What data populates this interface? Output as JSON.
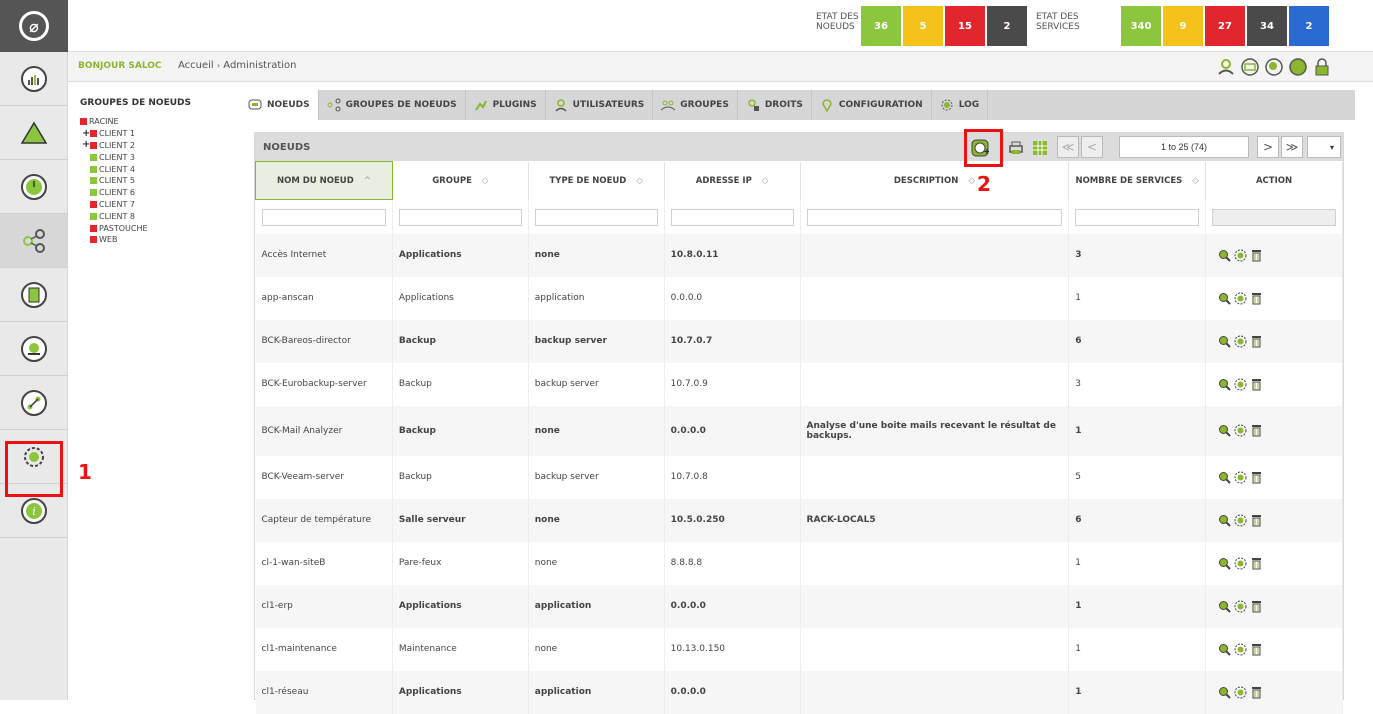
{
  "header": {
    "node_status_label": "ETAT DES NOEUDS",
    "node_stats": [
      {
        "value": "36",
        "color": "#8cc63f"
      },
      {
        "value": "5",
        "color": "#f4c21b"
      },
      {
        "value": "15",
        "color": "#e2262e"
      },
      {
        "value": "2",
        "color": "#4a4a4a"
      }
    ],
    "service_status_label": "ETAT DES SERVICES",
    "service_stats": [
      {
        "value": "340",
        "color": "#8cc63f"
      },
      {
        "value": "9",
        "color": "#f4c21b"
      },
      {
        "value": "27",
        "color": "#e2262e"
      },
      {
        "value": "34",
        "color": "#4a4a4a"
      },
      {
        "value": "2",
        "color": "#2a6bd1"
      }
    ]
  },
  "breadcrumb": {
    "greeting": "BONJOUR SALOC",
    "home": "Accueil",
    "separator": "›",
    "current": "Administration"
  },
  "annotations": {
    "one": "1",
    "two": "2"
  },
  "tree": {
    "title": "GROUPES DE NOEUDS",
    "nodes": [
      {
        "label": "RACINE",
        "color": "#e2262e",
        "plus": false,
        "indent": 0
      },
      {
        "label": "CLIENT 1",
        "color": "#e2262e",
        "plus": true,
        "indent": 1
      },
      {
        "label": "CLIENT 2",
        "color": "#e2262e",
        "plus": true,
        "indent": 1
      },
      {
        "label": "CLIENT 3",
        "color": "#8cc63f",
        "plus": false,
        "indent": 1
      },
      {
        "label": "CLIENT 4",
        "color": "#8cc63f",
        "plus": false,
        "indent": 1
      },
      {
        "label": "CLIENT 5",
        "color": "#8cc63f",
        "plus": false,
        "indent": 1
      },
      {
        "label": "CLIENT 6",
        "color": "#8cc63f",
        "plus": false,
        "indent": 1
      },
      {
        "label": "CLIENT 7",
        "color": "#e2262e",
        "plus": false,
        "indent": 1
      },
      {
        "label": "CLIENT 8",
        "color": "#8cc63f",
        "plus": false,
        "indent": 1
      },
      {
        "label": "PASTOUCHE",
        "color": "#e2262e",
        "plus": false,
        "indent": 1
      },
      {
        "label": "WEB",
        "color": "#e2262e",
        "plus": false,
        "indent": 1
      }
    ]
  },
  "tabs": [
    {
      "label": "NOEUDS",
      "icon": "monitor-icon",
      "active": true
    },
    {
      "label": "GROUPES DE NOEUDS",
      "icon": "share-icon",
      "active": false
    },
    {
      "label": "PLUGINS",
      "icon": "plugin-icon",
      "active": false
    },
    {
      "label": "UTILISATEURS",
      "icon": "user-icon",
      "active": false
    },
    {
      "label": "GROUPES",
      "icon": "users-icon",
      "active": false
    },
    {
      "label": "DROITS",
      "icon": "rights-icon",
      "active": false
    },
    {
      "label": "CONFIGURATION",
      "icon": "pin-icon",
      "active": false
    },
    {
      "label": "LOG",
      "icon": "gear-icon",
      "active": false
    }
  ],
  "panel": {
    "title": "NOEUDS",
    "pagination": "1 to 25 (74)",
    "first": "≪",
    "prev": "<",
    "next": ">",
    "last": "≫",
    "page_size_arrow": "▾"
  },
  "table": {
    "columns": [
      {
        "label": "NOM DU NOEUD",
        "sort": "^"
      },
      {
        "label": "GROUPE",
        "sort": "◇"
      },
      {
        "label": "TYPE DE NOEUD",
        "sort": "◇"
      },
      {
        "label": "ADRESSE IP",
        "sort": "◇"
      },
      {
        "label": "DESCRIPTION",
        "sort": "◇"
      },
      {
        "label": "NOMBRE DE SERVICES",
        "sort": "◇"
      },
      {
        "label": "ACTION",
        "sort": ""
      }
    ],
    "rows": [
      {
        "name": "Accès Internet",
        "group": "Applications",
        "type": "none",
        "ip": "10.8.0.11",
        "description": "",
        "services": "3",
        "bold": true
      },
      {
        "name": "app-anscan",
        "group": "Applications",
        "type": "application",
        "ip": "0.0.0.0",
        "description": "",
        "services": "1",
        "bold": false
      },
      {
        "name": "BCK-Bareos-director",
        "group": "Backup",
        "type": "backup server",
        "ip": "10.7.0.7",
        "description": "",
        "services": "6",
        "bold": true
      },
      {
        "name": "BCK-Eurobackup-server",
        "group": "Backup",
        "type": "backup server",
        "ip": "10.7.0.9",
        "description": "",
        "services": "3",
        "bold": false
      },
      {
        "name": "BCK-Mail Analyzer",
        "group": "Backup",
        "type": "none",
        "ip": "0.0.0.0",
        "description": "Analyse d'une boite mails recevant le résultat de backups.",
        "services": "1",
        "bold": true
      },
      {
        "name": "BCK-Veeam-server",
        "group": "Backup",
        "type": "backup server",
        "ip": "10.7.0.8",
        "description": "",
        "services": "5",
        "bold": false
      },
      {
        "name": "Capteur de température",
        "group": "Salle serveur",
        "type": "none",
        "ip": "10.5.0.250",
        "description": "RACK-LOCAL5",
        "services": "6",
        "bold": true
      },
      {
        "name": "cl-1-wan-siteB",
        "group": "Pare-feux",
        "type": "none",
        "ip": "8.8.8.8",
        "description": "",
        "services": "1",
        "bold": false
      },
      {
        "name": "cl1-erp",
        "group": "Applications",
        "type": "application",
        "ip": "0.0.0.0",
        "description": "",
        "services": "1",
        "bold": true
      },
      {
        "name": "cl1-maintenance",
        "group": "Maintenance",
        "type": "none",
        "ip": "10.13.0.150",
        "description": "",
        "services": "1",
        "bold": false
      },
      {
        "name": "cl1-réseau",
        "group": "Applications",
        "type": "application",
        "ip": "0.0.0.0",
        "description": "",
        "services": "1",
        "bold": true
      }
    ]
  },
  "colors": {
    "accent_green": "#8cb62d",
    "annotation_red": "#e11111"
  }
}
